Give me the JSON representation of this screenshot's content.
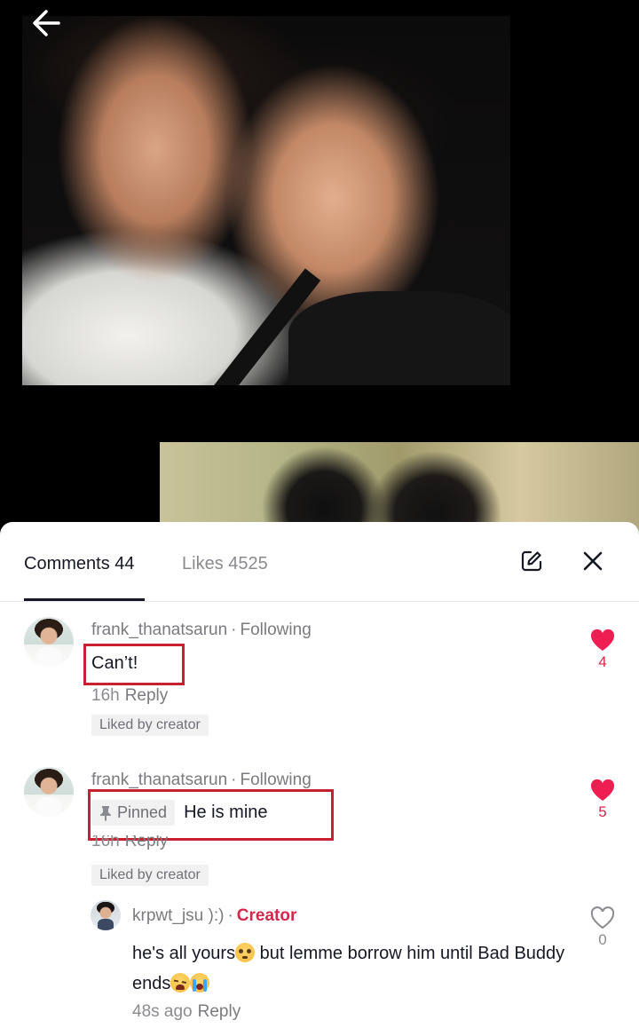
{
  "photo": {
    "back_icon": "arrow-left-icon"
  },
  "header": {
    "tabs": [
      {
        "label": "Comments 44",
        "active": true
      },
      {
        "label": "Likes 4525",
        "active": false
      }
    ],
    "edit_icon": "edit-icon",
    "close_icon": "close-icon"
  },
  "comments": [
    {
      "username": "frank_thanatsarun",
      "separator": "·",
      "relation": "Following",
      "text": "Can’t!",
      "time": "16h",
      "reply_label": "Reply",
      "badge": "Liked by creator",
      "likes": "4",
      "liked": true
    },
    {
      "username": "frank_thanatsarun",
      "separator": "·",
      "relation": "Following",
      "pinned_label": "Pinned",
      "text": "He is mine",
      "time": "16h",
      "reply_label": "Reply",
      "badge": "Liked by creator",
      "likes": "5",
      "liked": true,
      "replies": [
        {
          "username": "krpwt_jsu ):)",
          "separator": "·",
          "role": "Creator",
          "text_part1": "he's all yours",
          "text_part2": " but lemme borrow him until Bad Buddy ends",
          "time": "48s ago",
          "reply_label": "Reply",
          "likes": "0",
          "liked": false
        }
      ]
    }
  ],
  "colors": {
    "accent_red": "#d3284b",
    "highlight_box": "#c8202e",
    "text_primary": "#161823",
    "text_secondary": "#8a8b91"
  }
}
